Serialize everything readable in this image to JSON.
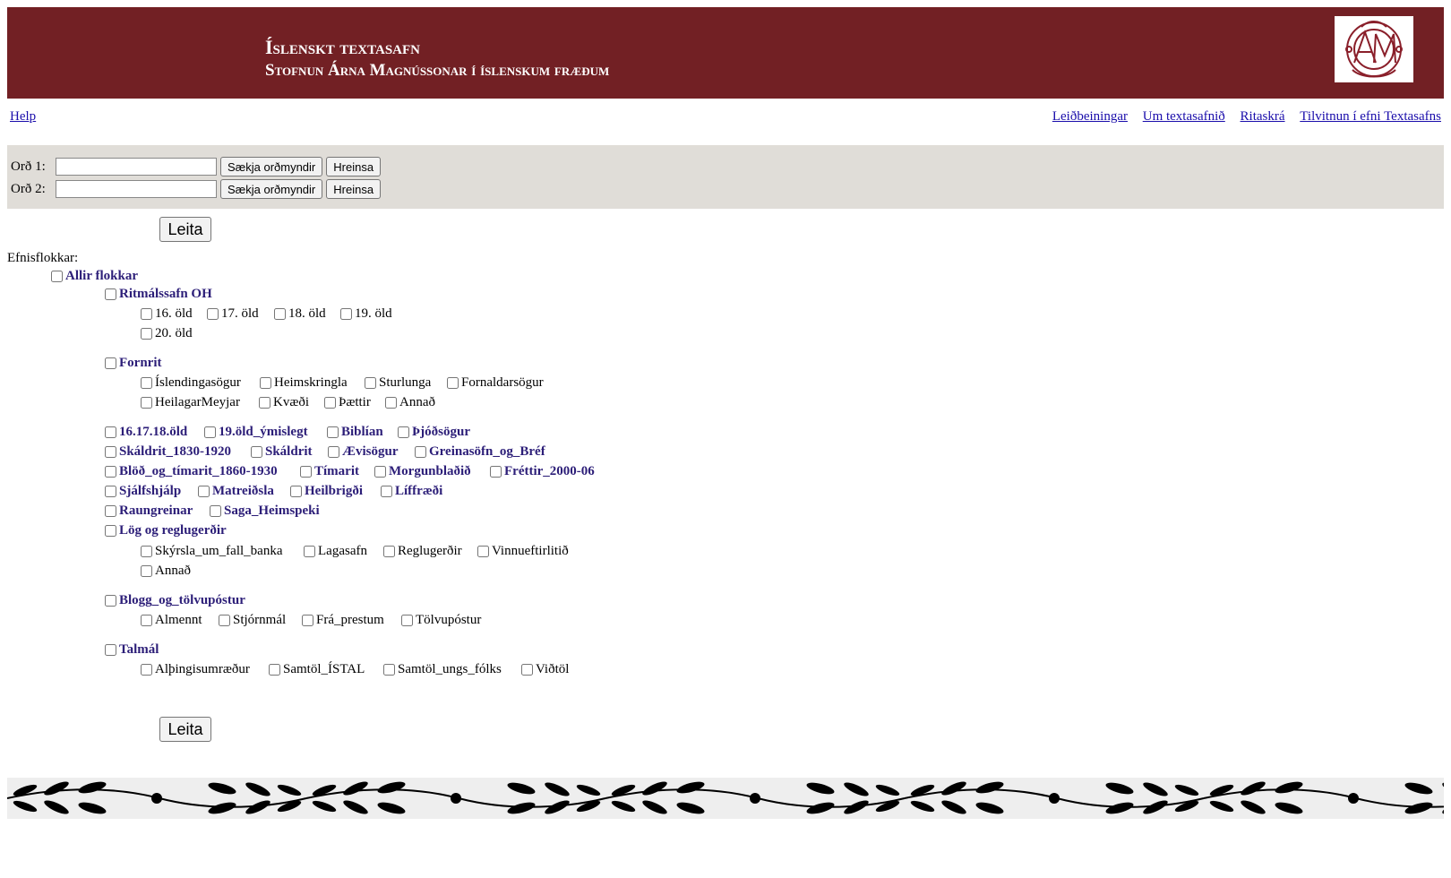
{
  "header": {
    "title": "Íslenskt textasafn",
    "subtitle": "Stofnun Árna Magnússonar í íslenskum fræðum",
    "colors": {
      "banner": "#722024",
      "text": "#ffffff"
    },
    "logo_icon": "manuscript-monogram-logo"
  },
  "nav": {
    "help": "Help",
    "right": [
      "Leiðbeiningar",
      "Um textasafnið",
      "Ritaskrá",
      "Tilvitnun í efni Textasafns"
    ]
  },
  "word_search": {
    "rows": [
      {
        "label": "Orð 1:",
        "value": "",
        "fetch_button": "Sækja orðmyndir",
        "clear_button": "Hreinsa"
      },
      {
        "label": "Orð 2:",
        "value": "",
        "fetch_button": "Sækja orðmyndir",
        "clear_button": "Hreinsa"
      }
    ],
    "search_button": "Leita"
  },
  "categories": {
    "heading": "Efnisflokkar:",
    "all": "Allir flokkar",
    "ritmalssafn": {
      "label": "Ritmálssafn OH",
      "items": [
        "16. öld",
        "17. öld",
        "18. öld",
        "19. öld",
        "20. öld"
      ]
    },
    "fornrit": {
      "label": "Fornrit",
      "items": [
        "Íslendingasögur",
        "Heimskringla",
        "Sturlunga",
        "Fornaldarsögur",
        "HeilagarMeyjar",
        "Kvæði",
        "Þættir",
        "Annað"
      ]
    },
    "groups": [
      "16.17.18.öld",
      "19.öld_ýmislegt",
      "Biblían",
      "Þjóðsögur",
      "Skáldrit_1830-1920",
      "Skáldrit",
      "Ævisögur",
      "Greinasöfn_og_Bréf",
      "Blöð_og_tímarit_1860-1930",
      "Tímarit",
      "Morgunblaðið",
      "Fréttir_2000-06",
      "Sjálfshjálp",
      "Matreiðsla",
      "Heilbrigði",
      "Líffræði",
      "Raungreinar",
      "Saga_Heimspeki"
    ],
    "log": {
      "label": "Lög og reglugerðir",
      "items": [
        "Skýrsla_um_fall_banka",
        "Lagasafn",
        "Reglugerðir",
        "Vinnueftirlitið",
        "Annað"
      ]
    },
    "blogg": {
      "label": "Blogg_og_tölvupóstur",
      "items": [
        "Almennt",
        "Stjórnmál",
        "Frá_prestum",
        "Tölvupóstur"
      ]
    },
    "talmal": {
      "label": "Talmál",
      "items": [
        "Alþingisumræður",
        "Samtöl_ÍSTAL",
        "Samtöl_ungs_fólks",
        "Viðtöl"
      ]
    }
  },
  "footer": {
    "ornament_icon": "laurel-garland-ornament"
  }
}
